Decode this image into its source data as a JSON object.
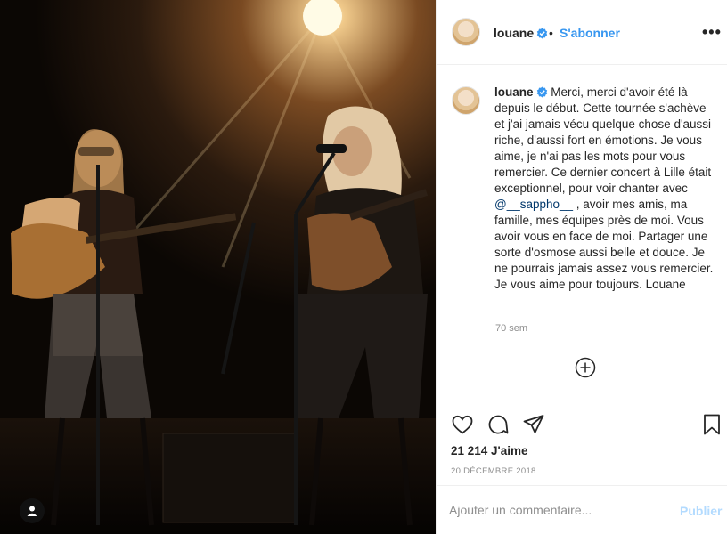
{
  "post": {
    "username": "louane",
    "follow_label": "S'abonner",
    "separator": "•",
    "more_label": "•••",
    "caption_before_mention": "Merci, merci d'avoir été là depuis le début. Cette tournée s'achève et j'ai jamais vécu quelque chose d'aussi riche, d'aussi fort en émotions. Je vous aime, je n'ai pas les mots pour vous remercier. Ce dernier concert à Lille était exceptionnel, pour voir chanter avec ",
    "caption_mention": "@__sappho__",
    "caption_after_mention": " , avoir mes amis, ma famille, mes équipes près de moi. Vous avoir vous en face de moi. Partager une sorte d'osmose aussi belle et douce. Je ne pourrais jamais assez vous remercier. Je vous aime pour toujours. Louane",
    "time_ago": "70 sem",
    "likes": "21 214 J'aime",
    "date": "20 DÉCEMBRE 2018"
  },
  "comment_box": {
    "placeholder": "Ajouter un commentaire...",
    "publish_label": "Publier"
  },
  "colors": {
    "accent": "#3897f0",
    "verified": "#3897f0",
    "publish_disabled": "#b3dbff",
    "muted": "#8e8e8e",
    "text": "#262626"
  },
  "icons": [
    "verified-badge-icon",
    "more-icon",
    "load-more-comments-icon",
    "heart-icon",
    "comment-icon",
    "share-icon",
    "save-bookmark-icon",
    "user-tag-icon"
  ]
}
